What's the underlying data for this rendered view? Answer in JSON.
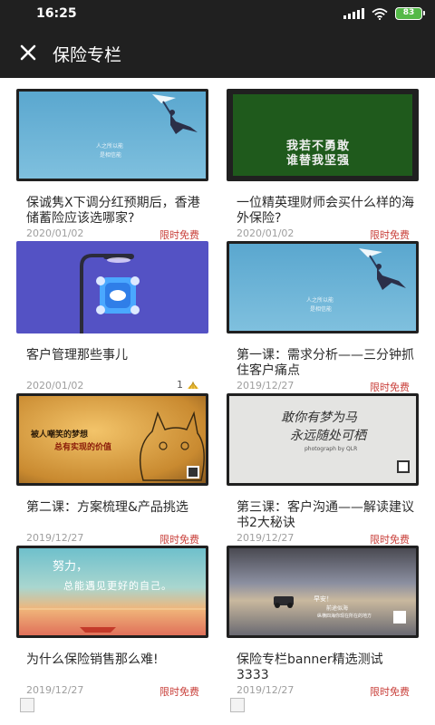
{
  "status_bar": {
    "time": "16:25",
    "battery": "83"
  },
  "header": {
    "title": "保险专栏"
  },
  "cards": [
    {
      "title": "保诚隽X下调分红预期后，香港储蓄险应该选哪家?",
      "date": "2020/01/02",
      "tag": "限时免费",
      "thumb": {
        "line1": "人之所以能",
        "line2": "是相信能"
      }
    },
    {
      "title": "一位精英理财师会买什么样的海外保险?",
      "date": "2020/01/02",
      "tag": "限时免费",
      "thumb": {
        "line1": "我若不勇敢",
        "line2": "谁替我坚强"
      }
    },
    {
      "title": "客户管理那些事儿",
      "date": "2020/01/02",
      "likes": "1"
    },
    {
      "title": "第一课：需求分析——三分钟抓住客户痛点",
      "date": "2019/12/27",
      "tag": "限时免费",
      "thumb": {
        "line1": "人之所以能",
        "line2": "是相信能"
      }
    },
    {
      "title": "第二课：方案梳理&产品挑选",
      "date": "2019/12/27",
      "tag": "限时免费",
      "thumb": {
        "line1": "被人嘲笑的梦想",
        "line2": "总有实现的价值"
      }
    },
    {
      "title": "第三课：客户沟通——解读建议书2大秘诀",
      "date": "2019/12/27",
      "tag": "限时免费",
      "thumb": {
        "line1": "敢你有梦为马",
        "line2": "永远随处可栖",
        "line3": "photograph by QLR"
      }
    },
    {
      "title": "为什么保险销售那么难!",
      "date": "2019/12/27",
      "tag": "限时免费",
      "thumb": {
        "line1": "努力，",
        "line2": "总能遇见更好的自己。"
      }
    },
    {
      "title": "保险专栏banner精选测试3333",
      "date": "2019/12/27",
      "tag": "限时免费",
      "thumb": {
        "line1": "早安！",
        "line2": "前途似海",
        "line3": "纵横四海你现在所在的地方"
      }
    }
  ]
}
